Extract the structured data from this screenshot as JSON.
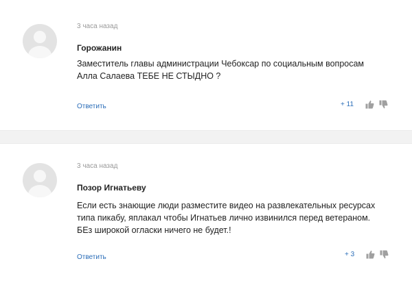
{
  "comments": [
    {
      "time": "3 часа назад",
      "author": "Горожанин",
      "text_lines": [
        "Заместитель главы администрации Чебоксар по социальным вопросам",
        "Алла Салаева ТЕБЕ НЕ СТЫДНО ?"
      ],
      "reply_label": "Ответить",
      "rating": "+ 11",
      "icons": {
        "avatar": "user-avatar-icon",
        "like": "thumbs-up-icon",
        "dislike": "thumbs-down-icon"
      }
    },
    {
      "time": "3 часа назад",
      "author": "Позор Игнатьеву",
      "text_lines": [
        "Если есть знающие люди разместите видео на развлекательных ресурсах",
        "типа пикабу, яплакал чтобы Игнатьев лично извинился перед ветераном.",
        "БЕз широкой огласки ничего не будет.!"
      ],
      "reply_label": "Ответить",
      "rating": "+ 3",
      "icons": {
        "avatar": "user-avatar-icon",
        "like": "thumbs-up-icon",
        "dislike": "thumbs-down-icon"
      }
    }
  ],
  "colors": {
    "link": "#2a6db8",
    "muted": "#999999",
    "separator": "#f2f2f2",
    "avatar_bg": "#e3e3e3",
    "avatar_fg": "#f7f7f7",
    "icon": "#a0a0a0"
  }
}
